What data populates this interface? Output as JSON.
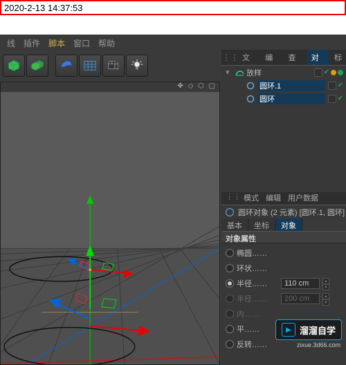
{
  "timestamp": "2020-2-13 14:37:53",
  "menu": {
    "items": [
      "线",
      "插件",
      "脚本",
      "窗口",
      "帮助"
    ],
    "highlighted_index": 2
  },
  "toolbar_icons": [
    "cube",
    "cubes",
    "blue-shape",
    "grid",
    "camera",
    "light"
  ],
  "viewport": {
    "title_icons": "✥ ◇ ⬡ ▢"
  },
  "manager_tabs": {
    "items": [
      "文件",
      "编辑",
      "查看",
      "对象",
      "标"
    ],
    "active": 3
  },
  "scene_tree": [
    {
      "name": "放样",
      "icon": "loft",
      "icon_color": "#2fd6a4",
      "selected": false,
      "indent": 0,
      "expanded": true,
      "visA": true,
      "dotA": "#e29a00",
      "dotB": "#1fa05e"
    },
    {
      "name": "圆环.1",
      "icon": "circle",
      "icon_color": "#6aa6d8",
      "selected": true,
      "indent": 1,
      "expanded": false,
      "visA": true,
      "dotA": null,
      "dotB": null
    },
    {
      "name": "圆环",
      "icon": "circle",
      "icon_color": "#6aa6d8",
      "selected": true,
      "indent": 1,
      "expanded": false,
      "visA": true,
      "dotA": null,
      "dotB": null
    }
  ],
  "attr_tabs": {
    "items": [
      "模式",
      "编辑",
      "用户数据"
    ]
  },
  "attr_title": "圆环对象 (2 元素) [圆环.1, 圆环]",
  "attr_subtabs": {
    "items": [
      "基本",
      "坐标",
      "对象"
    ],
    "active": 2
  },
  "attr_section": "对象属性",
  "attr_rows": [
    {
      "label": "椭圆……",
      "radio": false,
      "dim": false,
      "input": null
    },
    {
      "label": "环状……",
      "radio": false,
      "dim": false,
      "input": null
    },
    {
      "label": "半径……",
      "radio": true,
      "dim": false,
      "input": "110 cm"
    },
    {
      "label": "半径……",
      "radio": false,
      "dim": true,
      "input": "200 cm"
    },
    {
      "label": "内……",
      "radio": false,
      "dim": true,
      "input": ""
    },
    {
      "label": "平……",
      "radio": false,
      "dim": false,
      "input": null
    },
    {
      "label": "反转……",
      "radio": false,
      "dim": false,
      "input": null
    }
  ],
  "watermark": {
    "text": "溜溜自学",
    "url": "zixue.3d66.com"
  }
}
